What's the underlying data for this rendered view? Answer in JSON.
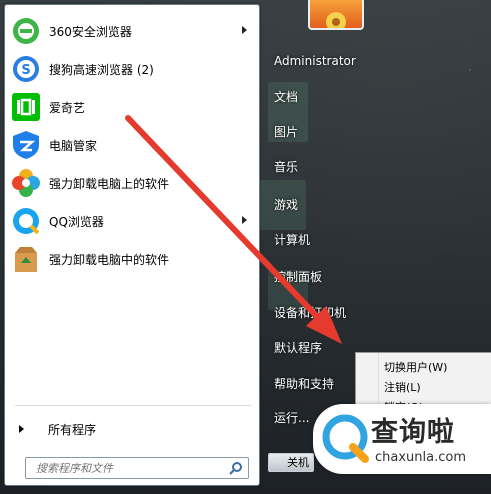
{
  "programs": [
    {
      "label": "360安全浏览器",
      "icon": "360-browser-icon",
      "has_submenu": true
    },
    {
      "label": "搜狗高速浏览器 (2)",
      "icon": "sogou-browser-icon",
      "has_submenu": false
    },
    {
      "label": "爱奇艺",
      "icon": "iqiyi-icon",
      "has_submenu": false
    },
    {
      "label": "电脑管家",
      "icon": "pc-manager-icon",
      "has_submenu": false
    },
    {
      "label": "强力卸载电脑上的软件",
      "icon": "uninstaller-icon",
      "has_submenu": false
    },
    {
      "label": "QQ浏览器",
      "icon": "qq-browser-icon",
      "has_submenu": true
    },
    {
      "label": "强力卸载电脑中的软件",
      "icon": "recycle-box-icon",
      "has_submenu": false
    }
  ],
  "all_programs_label": "所有程序",
  "search": {
    "placeholder": "搜索程序和文件"
  },
  "right": {
    "username": "Administrator",
    "links": [
      "文档",
      "图片",
      "音乐",
      "游戏",
      "计算机",
      "控制面板",
      "设备和打印机",
      "默认程序",
      "帮助和支持",
      "运行..."
    ]
  },
  "shutdown_label": "关机",
  "submenu": [
    "切换用户(W)",
    "注销(L)",
    "锁定(O)"
  ],
  "watermark": {
    "logo_text": "查询啦",
    "domain": "chaxunla.com"
  },
  "colors": {
    "annotation_arrow": "#e53a2e",
    "menu_dark": "#1e2328"
  }
}
